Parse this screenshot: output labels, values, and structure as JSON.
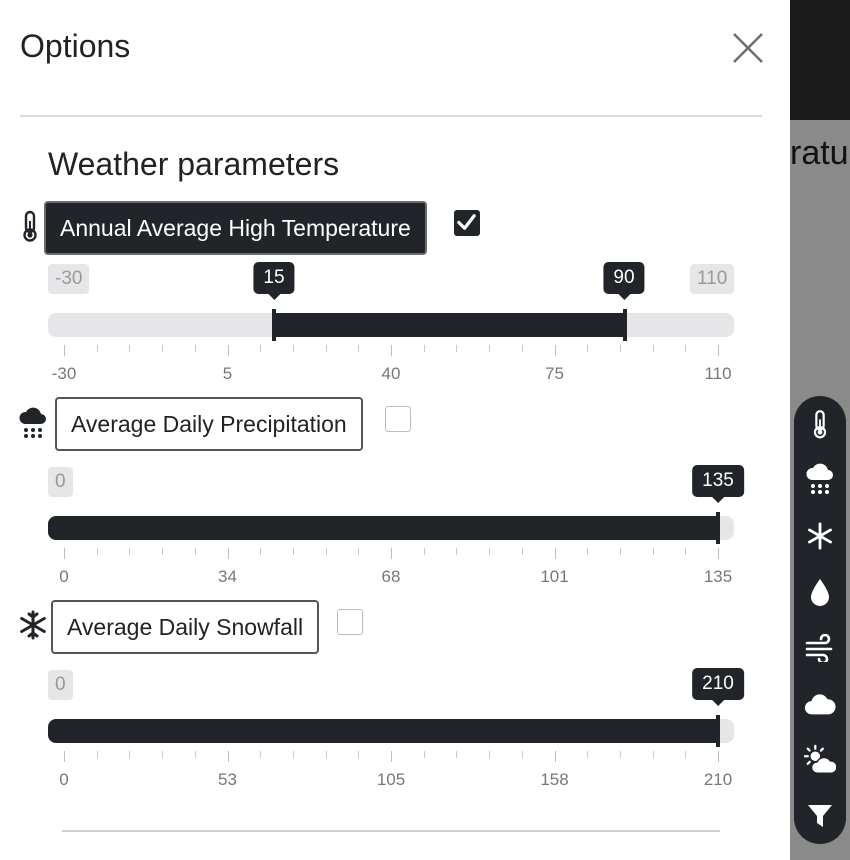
{
  "drawer": {
    "title": "Options",
    "section_title": "Weather parameters"
  },
  "background": {
    "partial_text": "ratu"
  },
  "parameters": [
    {
      "name": "Annual Average High Temperature",
      "icon": "thermometer-icon",
      "checked": true,
      "min": "-30",
      "max": "110",
      "low": "15",
      "high": "90",
      "ticks": [
        "-30",
        "5",
        "40",
        "75",
        "110"
      ]
    },
    {
      "name": "Average Daily Precipitation",
      "icon": "cloud-rain-icon",
      "checked": false,
      "min": "0",
      "max": "",
      "high": "135",
      "ticks": [
        "0",
        "34",
        "68",
        "101",
        "135"
      ]
    },
    {
      "name": "Average Daily Snowfall",
      "icon": "snowflake-icon",
      "checked": false,
      "min": "0",
      "max": "",
      "high": "210",
      "ticks": [
        "0",
        "53",
        "105",
        "158",
        "210"
      ]
    }
  ],
  "dock": {
    "items": [
      "thermometer-icon",
      "cloud-rain-icon",
      "snowflake-icon",
      "droplet-icon",
      "wind-icon",
      "cloud-icon",
      "sun-cloud-icon",
      "filter-icon"
    ]
  },
  "colors": {
    "dark": "#212529",
    "track": "#e6e6e9",
    "background_peek": "#8a8a8a"
  }
}
